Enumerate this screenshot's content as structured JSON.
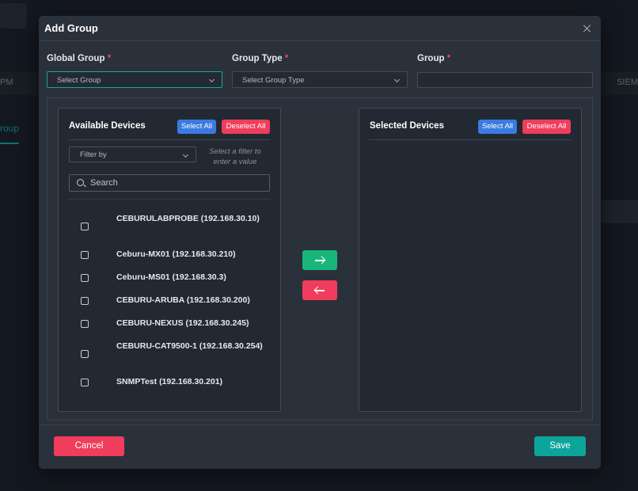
{
  "background": {
    "left_fragment": "PM",
    "right_fragment": "SIEM",
    "tab_fragment": "roup"
  },
  "modal": {
    "title": "Add Group",
    "fields": {
      "global_group": {
        "label": "Global Group",
        "required_mark": "*",
        "placeholder": "Select Group"
      },
      "group_type": {
        "label": "Group Type",
        "required_mark": "*",
        "placeholder": "Select Group Type"
      },
      "group": {
        "label": "Group",
        "required_mark": "*",
        "value": ""
      }
    },
    "available": {
      "title": "Available Devices",
      "select_all": "Select All",
      "deselect_all": "Deselect All",
      "filter_placeholder": "Filter by",
      "filter_hint": "Select a filter to enter a value",
      "search_placeholder": "Search",
      "devices": [
        {
          "label": "CEBURULABPROBE (192.168.30.10)",
          "checked": false
        },
        {
          "label": "Ceburu-MX01 (192.168.30.210)",
          "checked": false
        },
        {
          "label": "Ceburu-MS01 (192.168.30.3)",
          "checked": false
        },
        {
          "label": "CEBURU-ARUBA (192.168.30.200)",
          "checked": false
        },
        {
          "label": "CEBURU-NEXUS (192.168.30.245)",
          "checked": false
        },
        {
          "label": "CEBURU-CAT9500-1 (192.168.30.254)",
          "checked": false
        },
        {
          "label": "SNMPTest (192.168.30.201)",
          "checked": false
        }
      ]
    },
    "selected": {
      "title": "Selected Devices",
      "select_all": "Select All",
      "deselect_all": "Deselect All"
    },
    "footer": {
      "cancel": "Cancel",
      "save": "Save"
    }
  },
  "colors": {
    "accent": "#13a89e",
    "danger": "#ef3d5b",
    "primary": "#3a7be0",
    "success": "#19b67a"
  }
}
